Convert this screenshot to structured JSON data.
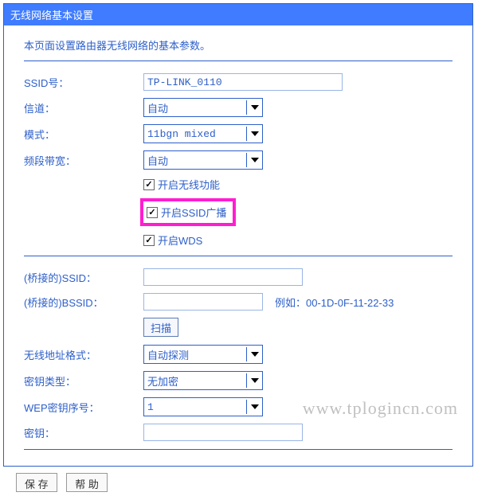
{
  "header": {
    "title": "无线网络基本设置"
  },
  "intro": "本页面设置路由器无线网络的基本参数。",
  "fields": {
    "ssid": {
      "label": "SSID号：",
      "value": "TP-LINK_0110"
    },
    "channel": {
      "label": "信道：",
      "value": "自动"
    },
    "mode": {
      "label": "模式：",
      "value": "11bgn mixed"
    },
    "bandwidth": {
      "label": "频段带宽：",
      "value": "自动"
    },
    "enable_wireless": {
      "label": "开启无线功能",
      "checked": true
    },
    "enable_ssid_broadcast": {
      "label": "开启SSID广播",
      "checked": true
    },
    "enable_wds": {
      "label": "开启WDS",
      "checked": true
    },
    "bridge_ssid": {
      "label": "(桥接的)SSID：",
      "value": ""
    },
    "bridge_bssid": {
      "label": "(桥接的)BSSID：",
      "value": "",
      "hint": "例如：00-1D-0F-11-22-33"
    },
    "scan_btn": "扫描",
    "addr_format": {
      "label": "无线地址格式：",
      "value": "自动探测"
    },
    "key_type": {
      "label": "密钥类型：",
      "value": "无加密"
    },
    "wep_index": {
      "label": "WEP密钥序号：",
      "value": "1"
    },
    "key": {
      "label": "密钥：",
      "value": ""
    }
  },
  "footer": {
    "save": "保 存",
    "help": "帮 助"
  },
  "watermark": "www.tplogincn.com"
}
